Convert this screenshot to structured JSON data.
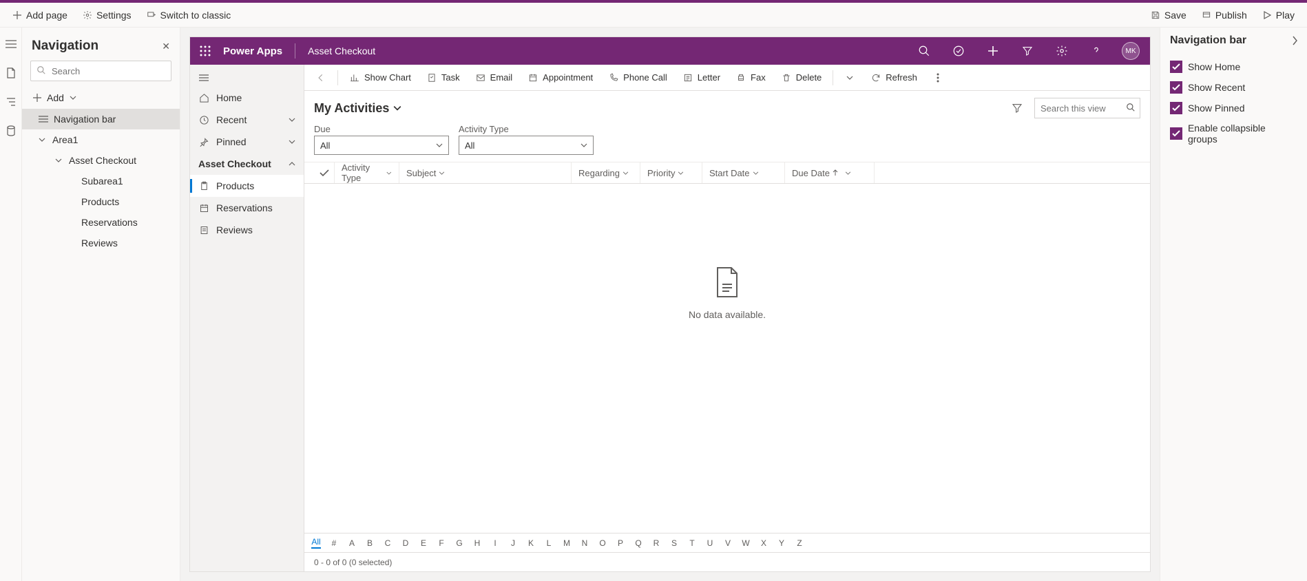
{
  "topbar": {
    "addPage": "Add page",
    "settings": "Settings",
    "switch": "Switch to classic",
    "save": "Save",
    "publish": "Publish",
    "play": "Play"
  },
  "navPanel": {
    "title": "Navigation",
    "searchPlaceholder": "Search",
    "addLabel": "Add",
    "items": {
      "navBar": "Navigation bar",
      "area1": "Area1",
      "assetCheckout": "Asset Checkout",
      "subarea1": "Subarea1",
      "products": "Products",
      "reservations": "Reservations",
      "reviews": "Reviews"
    }
  },
  "appHeader": {
    "brand": "Power Apps",
    "breadcrumb": "Asset Checkout",
    "avatar": "MK"
  },
  "innerNav": {
    "home": "Home",
    "recent": "Recent",
    "pinned": "Pinned",
    "group": "Asset Checkout",
    "products": "Products",
    "reservations": "Reservations",
    "reviews": "Reviews"
  },
  "commandBar": {
    "showChart": "Show Chart",
    "task": "Task",
    "email": "Email",
    "appointment": "Appointment",
    "phoneCall": "Phone Call",
    "letter": "Letter",
    "fax": "Fax",
    "delete": "Delete",
    "refresh": "Refresh"
  },
  "view": {
    "title": "My Activities",
    "searchPlaceholder": "Search this view",
    "filters": {
      "dueLabel": "Due",
      "dueValue": "All",
      "typeLabel": "Activity Type",
      "typeValue": "All"
    },
    "columns": {
      "activityType": "Activity Type",
      "subject": "Subject",
      "regarding": "Regarding",
      "priority": "Priority",
      "startDate": "Start Date",
      "dueDate": "Due Date"
    },
    "emptyMessage": "No data available.",
    "alphaAll": "All",
    "status": "0 - 0 of 0 (0 selected)"
  },
  "rightPanel": {
    "title": "Navigation bar",
    "showHome": "Show Home",
    "showRecent": "Show Recent",
    "showPinned": "Show Pinned",
    "collapsible": "Enable collapsible groups"
  }
}
